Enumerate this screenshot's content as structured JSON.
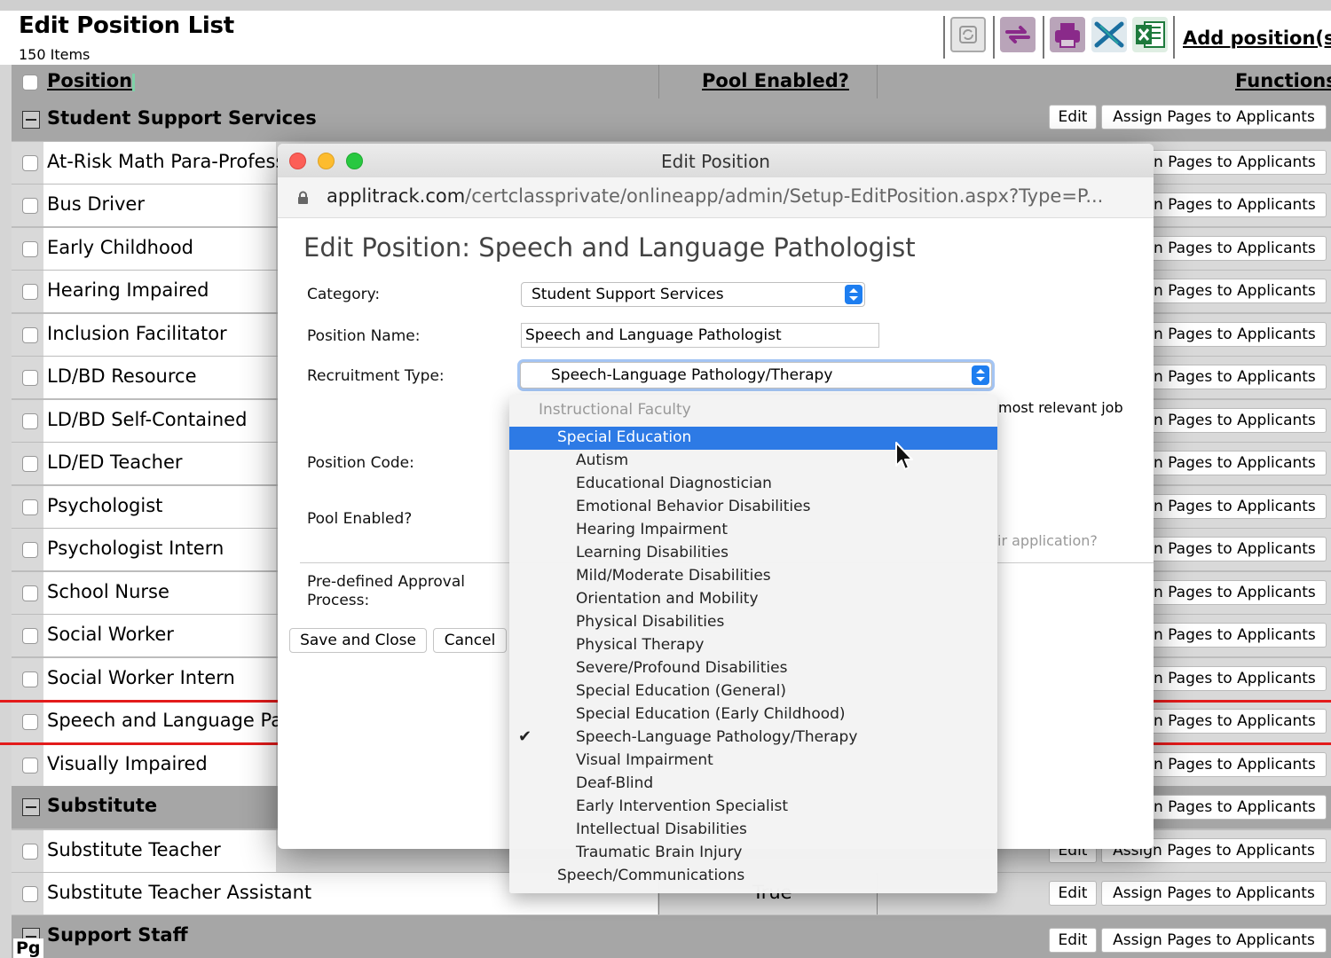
{
  "page": {
    "title": "Edit Position List",
    "item_count": "150 Items",
    "add_link": "Add position(s)"
  },
  "toolbar": {
    "icons": [
      "recycle-icon",
      "refresh-icon",
      "print-icon",
      "export-x-icon",
      "excel-icon"
    ],
    "colors": {
      "recycle": "#a9a9a9",
      "refresh": "#8a2a8a",
      "print": "#8a2a8a",
      "export": "#1a6fa0",
      "excel": "#1e7a3c"
    }
  },
  "table": {
    "headers": {
      "position": "Position",
      "pool": "Pool Enabled?",
      "functions": "Functions"
    },
    "edit_label": "Edit",
    "assign_label": "Assign Pages to Applicants",
    "assign_partial": "n Pages to Applicants",
    "groups": {
      "student_support": "Student Support Services",
      "substitute": "Substitute",
      "support_staff": "Support Staff"
    },
    "rows": [
      "At-Risk Math Para-Profession",
      "Bus Driver",
      "Early Childhood",
      "Hearing Impaired",
      "Inclusion Facilitator",
      "LD/BD Resource",
      "LD/BD Self-Contained",
      "LD/ED Teacher",
      "Psychologist",
      "Psychologist Intern",
      "School Nurse",
      "Social Worker",
      "Social Worker Intern",
      "Speech and Language Patho",
      "Visually Impaired",
      "Substitute Teacher",
      "Substitute Teacher Assistant"
    ],
    "pool_value": "True",
    "partial_edit": "Edit",
    "footer_partial": "Pg"
  },
  "modal": {
    "window_title": "Edit Position",
    "url_host": "applitrack.com",
    "url_path": "/certclassprivate/onlineapp/admin/Setup-EditPosition.aspx?Type=P...",
    "form_title": "Edit Position: Speech and Language Pathologist",
    "labels": {
      "category": "Category:",
      "position_name": "Position Name:",
      "recruitment_type": "Recruitment Type:",
      "position_code": "Position Code:",
      "pool_enabled": "Pool Enabled?",
      "approval_line1": "Pre-defined Approval",
      "approval_line2": "Process:"
    },
    "category_value": "Student Support Services",
    "position_name_value": "Speech and Language Pathologist",
    "recruitment_value": "Speech-Language Pathology/Therapy",
    "hint_relevant": "most relevant job",
    "hint_application": "ir application?",
    "save_button": "Save and Close",
    "cancel_button": "Cancel",
    "accent_color": "#1e7ef0"
  },
  "dropdown": {
    "header": "Instructional Faculty",
    "highlighted": "Special Education",
    "options": [
      "Autism",
      "Educational Diagnostician",
      "Emotional Behavior Disabilities",
      "Hearing Impairment",
      "Learning Disabilities",
      "Mild/Moderate Disabilities",
      "Orientation and Mobility",
      "Physical Disabilities",
      "Physical Therapy",
      "Severe/Profound Disabilities",
      "Special Education (General)",
      "Special Education (Early Childhood)",
      "Speech-Language Pathology/Therapy",
      "Visual Impairment",
      "Deaf-Blind",
      "Early Intervention Specialist",
      "Intellectual Disabilities",
      "Traumatic Brain Injury"
    ],
    "selected": "Speech-Language Pathology/Therapy",
    "subgroup": "Speech/Communications",
    "checkmark": "✔"
  }
}
